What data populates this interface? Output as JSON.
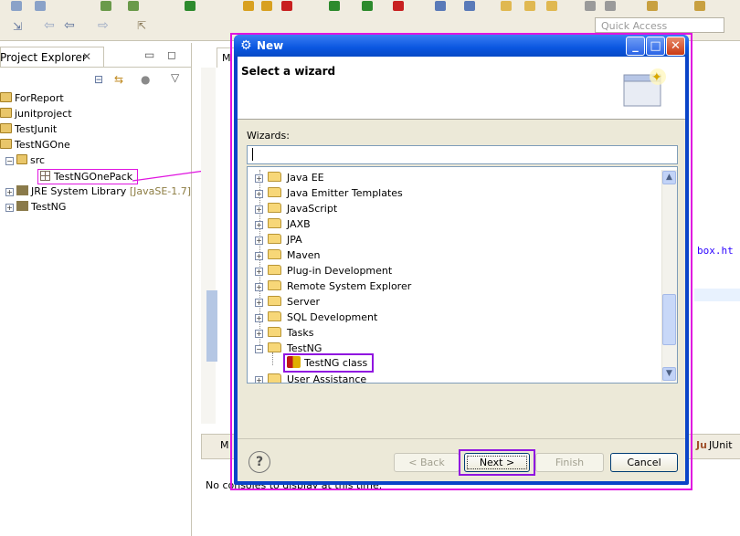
{
  "toolbar": {
    "quick_access_placeholder": "Quick Access"
  },
  "project_explorer": {
    "title": "Project Explorer",
    "close_glyph": "✕",
    "items": [
      {
        "label": "ForReport"
      },
      {
        "label": "junitproject"
      },
      {
        "label": "TestJunit"
      },
      {
        "label": "TestNGOne"
      },
      {
        "label": "src"
      },
      {
        "label": "TestNGOnePack"
      },
      {
        "label": "JRE System Library",
        "version": "[JavaSE-1.7]"
      },
      {
        "label": "TestNG"
      }
    ]
  },
  "editor": {
    "tab_label": "M",
    "code_fragment": "box.ht",
    "console_tab_label": "M",
    "junit_tab_label": "JUnit",
    "console_message": "No consoles to display at this time."
  },
  "wizard": {
    "window_title": "New",
    "heading": "Select a wizard",
    "filter_label": "Wizards:",
    "filter_value": "",
    "tree_items": [
      {
        "label": "Java EE",
        "expanded": false
      },
      {
        "label": "Java Emitter Templates",
        "expanded": false
      },
      {
        "label": "JavaScript",
        "expanded": false
      },
      {
        "label": "JAXB",
        "expanded": false
      },
      {
        "label": "JPA",
        "expanded": false
      },
      {
        "label": "Maven",
        "expanded": false
      },
      {
        "label": "Plug-in Development",
        "expanded": false
      },
      {
        "label": "Remote System Explorer",
        "expanded": false
      },
      {
        "label": "Server",
        "expanded": false
      },
      {
        "label": "SQL Development",
        "expanded": false
      },
      {
        "label": "Tasks",
        "expanded": false
      },
      {
        "label": "TestNG",
        "expanded": true
      },
      {
        "label": "TestNG class",
        "child": true
      },
      {
        "label": "User Assistance",
        "expanded": false
      }
    ],
    "buttons": {
      "help": "?",
      "back": "< Back",
      "next": "Next >",
      "finish": "Finish",
      "cancel": "Cancel"
    }
  },
  "colors": {
    "highlight_magenta": "#e014e0",
    "highlight_purple": "#9014e0",
    "titlebar_blue": "#0a56e0"
  }
}
